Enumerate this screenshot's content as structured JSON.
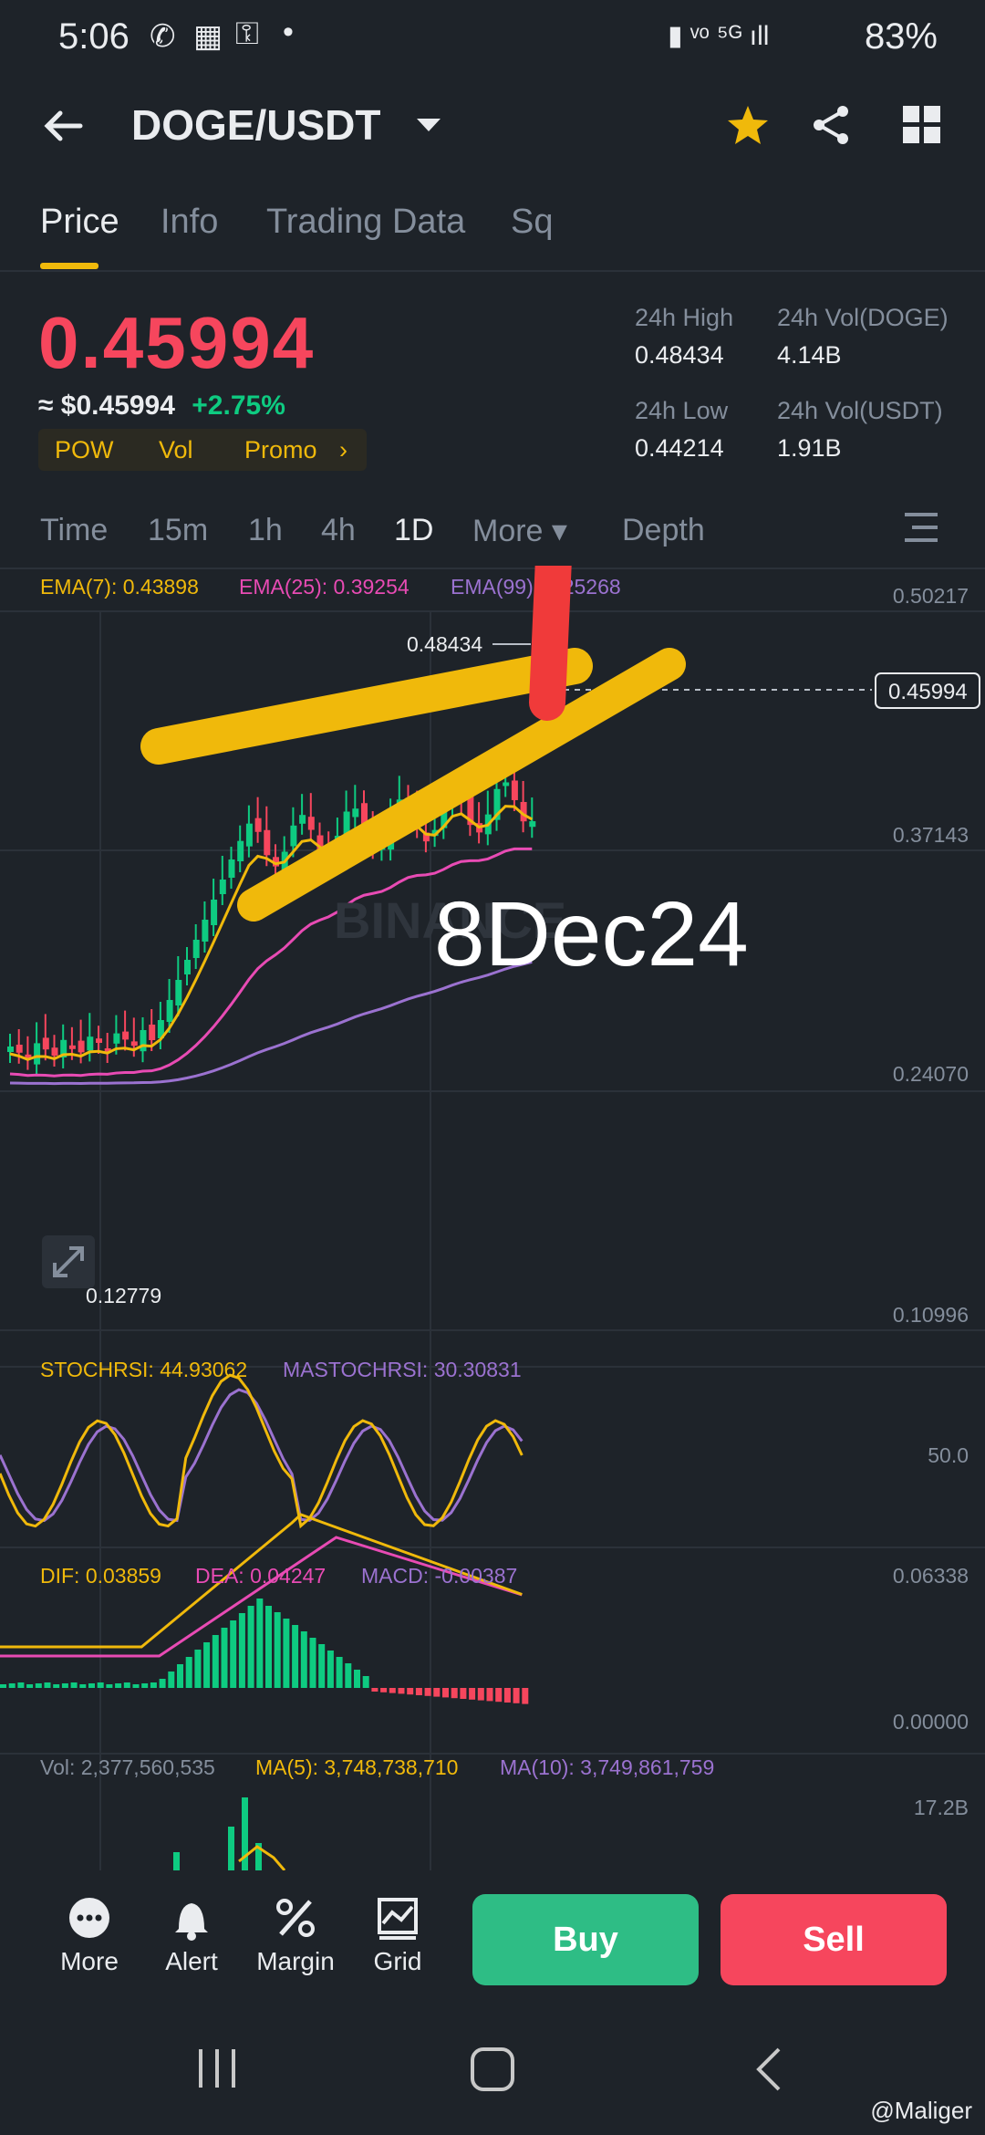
{
  "status_bar": {
    "time": "5:06",
    "battery": "83%"
  },
  "header": {
    "pair": "DOGE/USDT"
  },
  "tabs": [
    "Price",
    "Info",
    "Trading Data",
    "Sq"
  ],
  "price": {
    "last": "0.45994",
    "usd": "≈ $0.45994",
    "change": "+2.75%",
    "tags": [
      "POW",
      "Vol",
      "Promo"
    ]
  },
  "stats": {
    "high_label": "24h High",
    "high": "0.48434",
    "low_label": "24h Low",
    "low": "0.44214",
    "vol_doge_label": "24h Vol(DOGE)",
    "vol_doge": "4.14B",
    "vol_usdt_label": "24h Vol(USDT)",
    "vol_usdt": "1.91B"
  },
  "timeframes": [
    "Time",
    "15m",
    "1h",
    "4h",
    "1D",
    "More ▾",
    "Depth"
  ],
  "ema": {
    "ema7": "EMA(7): 0.43898",
    "ema25": "EMA(25): 0.39254",
    "ema99": "EMA(99): 0.25268"
  },
  "price_axis": [
    "0.50217",
    "0.37143",
    "0.24070",
    "0.10996"
  ],
  "chart": {
    "current_price_tag": "0.45994",
    "high_marker": "0.48434",
    "low_marker": "0.12779",
    "annotation": "8Dec24",
    "watermark": "BINANCE"
  },
  "stochrsi": {
    "label": "STOCHRSI: 44.93062",
    "ma_label": "MASTOCHRSI: 30.30831",
    "axis": "50.0"
  },
  "macd": {
    "dif": "DIF: 0.03859",
    "dea": "DEA: 0.04247",
    "macd": "MACD: -0.00387",
    "axis_top": "0.06338",
    "axis_zero": "0.00000"
  },
  "volume": {
    "vol": "Vol: 2,377,560,535",
    "ma5": "MA(5): 3,748,738,710",
    "ma10": "MA(10): 3,749,861,759",
    "axis": "17.2B"
  },
  "bottom_bar": {
    "items": [
      "More",
      "Alert",
      "Margin",
      "Grid"
    ],
    "buy": "Buy",
    "sell": "Sell"
  },
  "credit": "@Maliger",
  "colors": {
    "up": "#0ecb81",
    "down": "#f6465d",
    "accent": "#f0b90b",
    "bg": "#1e2329"
  }
}
